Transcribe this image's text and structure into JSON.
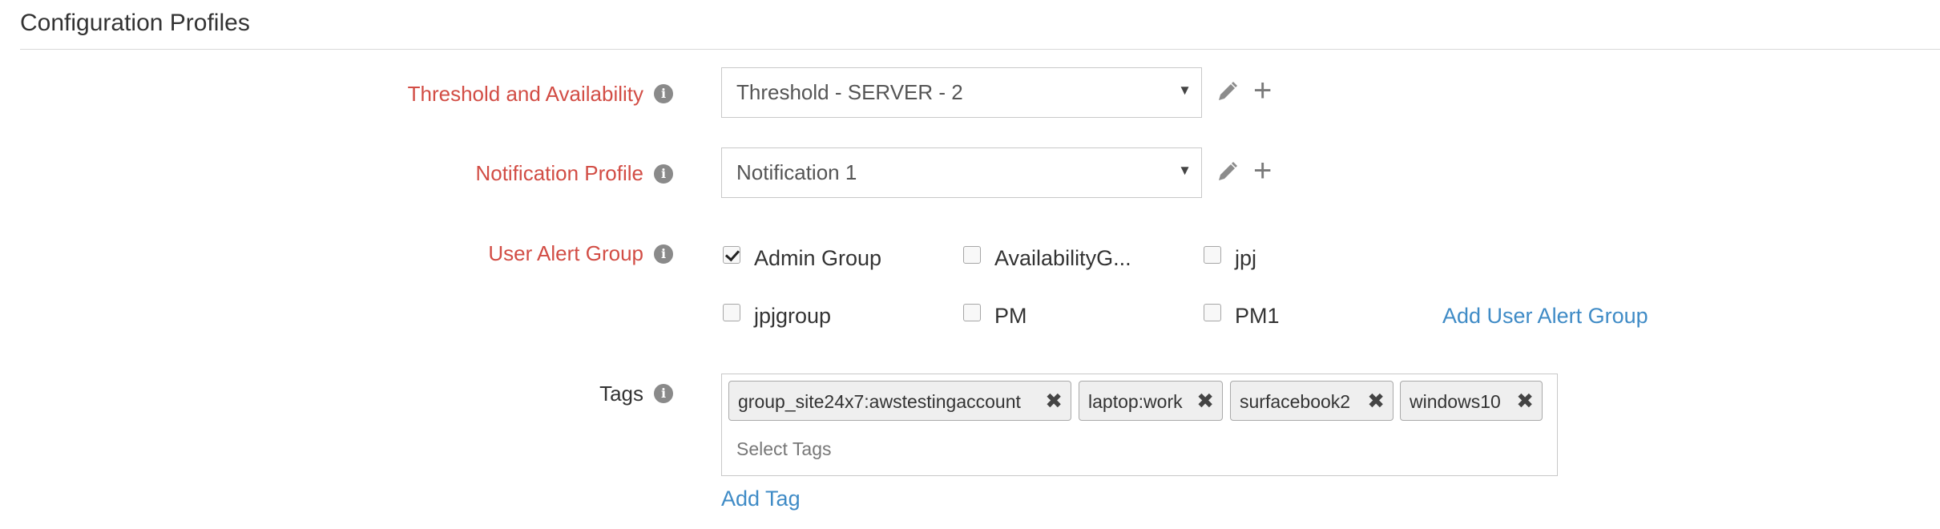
{
  "section": {
    "title": "Configuration Profiles"
  },
  "threshold": {
    "label": "Threshold and Availability",
    "selected": "Threshold - SERVER - 2",
    "info_icon": "info-icon",
    "edit_icon": "pencil-icon",
    "add_icon": "plus-icon"
  },
  "notification": {
    "label": "Notification Profile",
    "selected": "Notification 1",
    "info_icon": "info-icon",
    "edit_icon": "pencil-icon",
    "add_icon": "plus-icon"
  },
  "alert_group": {
    "label": "User Alert Group",
    "info_icon": "info-icon",
    "options": [
      {
        "label": "Admin Group",
        "checked": true
      },
      {
        "label": "AvailabilityG...",
        "checked": false
      },
      {
        "label": "jpj",
        "checked": false
      },
      {
        "label": "jpjgroup",
        "checked": false
      },
      {
        "label": "PM",
        "checked": false
      },
      {
        "label": "PM1",
        "checked": false
      }
    ],
    "add_link": "Add User Alert Group"
  },
  "tags": {
    "label": "Tags",
    "info_icon": "info-icon",
    "items": [
      {
        "text": "group_site24x7:awstestingaccount",
        "remove": "✖"
      },
      {
        "text": "laptop:work",
        "remove": "✖"
      },
      {
        "text": "surfacebook2",
        "remove": "✖"
      },
      {
        "text": "windows10",
        "remove": "✖"
      }
    ],
    "placeholder": "Select Tags",
    "add_link": "Add Tag"
  },
  "colors": {
    "required_label": "#d24d45",
    "link": "#3f8bc6",
    "border": "#c8c8c8"
  }
}
